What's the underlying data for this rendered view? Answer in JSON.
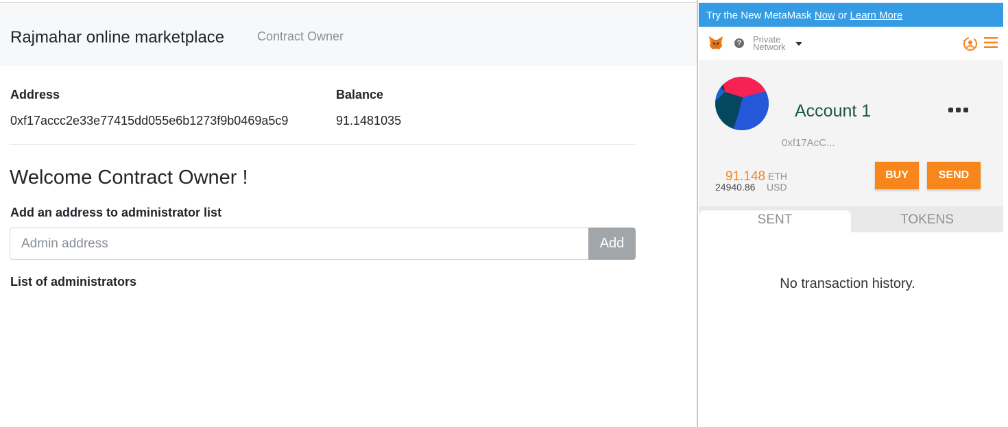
{
  "navbar": {
    "brand": "Rajmahar online marketplace",
    "link": "Contract Owner"
  },
  "account_info": {
    "address_label": "Address",
    "address_value": "0xf17accc2e33e77415dd055e6b1273f9b0469a5c9",
    "balance_label": "Balance",
    "balance_value": "91.1481035"
  },
  "owner": {
    "welcome": "Welcome Contract Owner !",
    "add_label": "Add an address to administrator list",
    "input_placeholder": "Admin address",
    "input_value": "",
    "add_button": "Add",
    "list_label": "List of administrators"
  },
  "metamask": {
    "banner": {
      "prefix": "Try the New MetaMask ",
      "now": "Now",
      "or": " or ",
      "learn": "Learn More"
    },
    "network_line1": "Private",
    "network_line2": "Network",
    "account_name": "Account 1",
    "account_address": "0xf17AcC...",
    "eth_amount": "91.148",
    "eth_unit": "ETH",
    "usd_amount": "24940.86",
    "usd_unit": "USD",
    "buy_button": "BUY",
    "send_button": "SEND",
    "tabs": [
      "SENT",
      "TOKENS"
    ],
    "empty_message": "No transaction history.",
    "colors": {
      "accent": "#f7861c",
      "banner": "#359be2",
      "account_name": "#16554a"
    },
    "icons": [
      "fox-logo-icon",
      "help-icon",
      "chevron-down-icon",
      "account-switch-icon",
      "hamburger-menu-icon",
      "more-options-icon"
    ]
  }
}
